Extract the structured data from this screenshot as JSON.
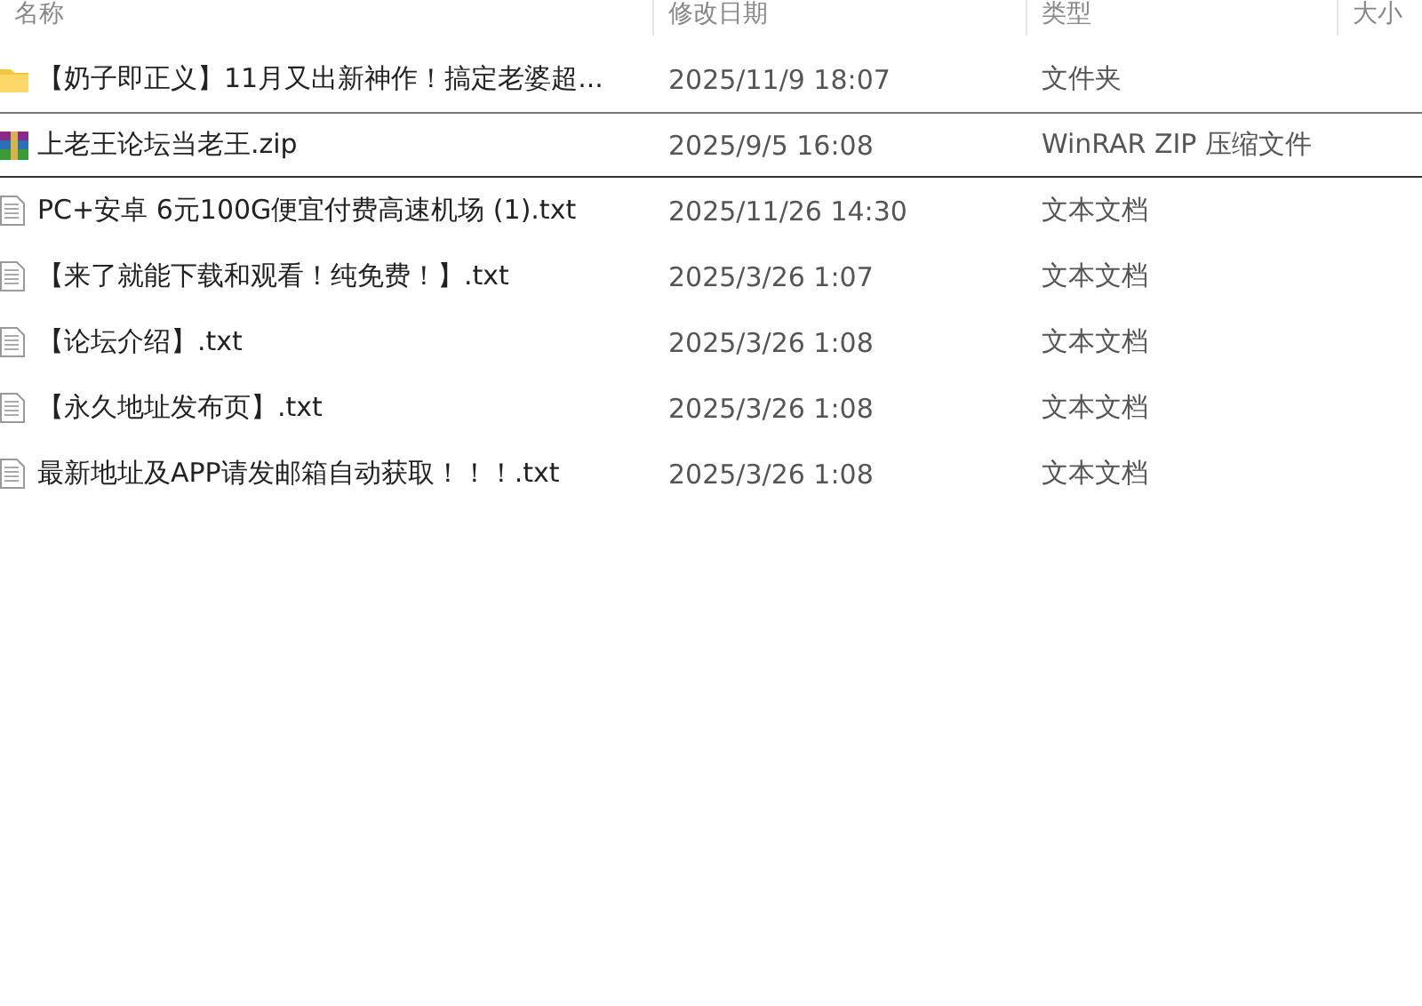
{
  "columns": [
    {
      "label": "名称"
    },
    {
      "label": "修改日期"
    },
    {
      "label": "类型"
    },
    {
      "label": "大小"
    }
  ],
  "files": [
    {
      "kind": "folder",
      "name": "【奶子即正义】11月又出新神作！搞定老婆超...",
      "modified": "2025/11/9 18:07",
      "type": "文件夹",
      "selected": false
    },
    {
      "kind": "zip",
      "name": "上老王论坛当老王.zip",
      "modified": "2025/9/5 16:08",
      "type": "WinRAR ZIP 压缩文件",
      "selected": true
    },
    {
      "kind": "txt",
      "name": "PC+安卓 6元100G便宜付费高速机场 (1).txt",
      "modified": "2025/11/26 14:30",
      "type": "文本文档",
      "selected": false
    },
    {
      "kind": "txt",
      "name": "【来了就能下载和观看！纯免费！】.txt",
      "modified": "2025/3/26 1:07",
      "type": "文本文档",
      "selected": false
    },
    {
      "kind": "txt",
      "name": "【论坛介绍】.txt",
      "modified": "2025/3/26 1:08",
      "type": "文本文档",
      "selected": false
    },
    {
      "kind": "txt",
      "name": "【永久地址发布页】.txt",
      "modified": "2025/3/26 1:08",
      "type": "文本文档",
      "selected": false
    },
    {
      "kind": "txt",
      "name": "最新地址及APP请发邮箱自动获取！！！.txt",
      "modified": "2025/3/26 1:08",
      "type": "文本文档",
      "selected": false
    }
  ]
}
